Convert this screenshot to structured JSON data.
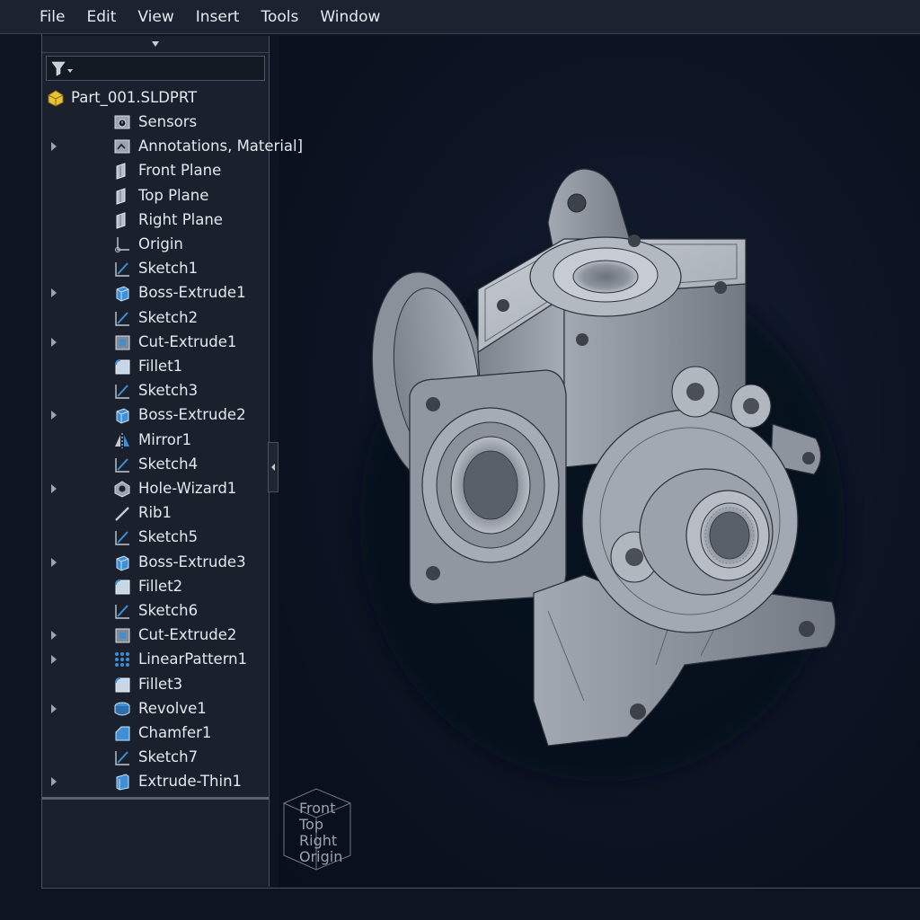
{
  "menu": [
    "File",
    "Edit",
    "View",
    "Insert",
    "Tools",
    "Window"
  ],
  "tree": {
    "root": "Part_001.SLDPRT",
    "items": [
      {
        "label": "Sensors",
        "icon": "sensor-icon",
        "expandable": false
      },
      {
        "label": "Annotations, Material]",
        "icon": "annotations-icon",
        "expandable": true
      },
      {
        "label": "Front Plane",
        "icon": "plane-icon",
        "expandable": false
      },
      {
        "label": "Top Plane",
        "icon": "plane-icon",
        "expandable": false
      },
      {
        "label": "Right Plane",
        "icon": "plane-icon",
        "expandable": false
      },
      {
        "label": "Origin",
        "icon": "origin-icon",
        "expandable": false
      },
      {
        "label": "Sketch1",
        "icon": "sketch-icon",
        "expandable": false
      },
      {
        "label": "Boss-Extrude1",
        "icon": "boss-extrude-icon",
        "expandable": true
      },
      {
        "label": "Sketch2",
        "icon": "sketch-icon",
        "expandable": false
      },
      {
        "label": "Cut-Extrude1",
        "icon": "cut-extrude-icon",
        "expandable": true
      },
      {
        "label": "Fillet1",
        "icon": "fillet-icon",
        "expandable": false
      },
      {
        "label": "Sketch3",
        "icon": "sketch-icon",
        "expandable": false
      },
      {
        "label": "Boss-Extrude2",
        "icon": "boss-extrude-icon",
        "expandable": true
      },
      {
        "label": "Mirror1",
        "icon": "mirror-icon",
        "expandable": false
      },
      {
        "label": "Sketch4",
        "icon": "sketch-icon",
        "expandable": false
      },
      {
        "label": "Hole-Wizard1",
        "icon": "hole-wizard-icon",
        "expandable": true
      },
      {
        "label": "Rib1",
        "icon": "rib-icon",
        "expandable": false
      },
      {
        "label": "Sketch5",
        "icon": "sketch-icon",
        "expandable": false
      },
      {
        "label": "Boss-Extrude3",
        "icon": "boss-extrude-icon",
        "expandable": true
      },
      {
        "label": "Fillet2",
        "icon": "fillet-icon",
        "expandable": false
      },
      {
        "label": "Sketch6",
        "icon": "sketch-icon",
        "expandable": false
      },
      {
        "label": "Cut-Extrude2",
        "icon": "cut-extrude-icon",
        "expandable": true
      },
      {
        "label": "LinearPattern1",
        "icon": "linear-pattern-icon",
        "expandable": true
      },
      {
        "label": "Fillet3",
        "icon": "fillet-icon",
        "expandable": false
      },
      {
        "label": "Revolve1",
        "icon": "revolve-icon",
        "expandable": true
      },
      {
        "label": "Chamfer1",
        "icon": "chamfer-icon",
        "expandable": false
      },
      {
        "label": "Sketch7",
        "icon": "sketch-icon",
        "expandable": false
      },
      {
        "label": "Extrude-Thin1",
        "icon": "extrude-thin-icon",
        "expandable": true
      }
    ]
  },
  "viewcube": {
    "labels": [
      "Front",
      "Top",
      "Right",
      "Origin"
    ]
  },
  "colors": {
    "background": "#0d1422",
    "panel": "#1a212d",
    "menubar": "#1c2330",
    "accent_blue": "#3d8fd8",
    "part_metal": "#9aa1ab"
  }
}
